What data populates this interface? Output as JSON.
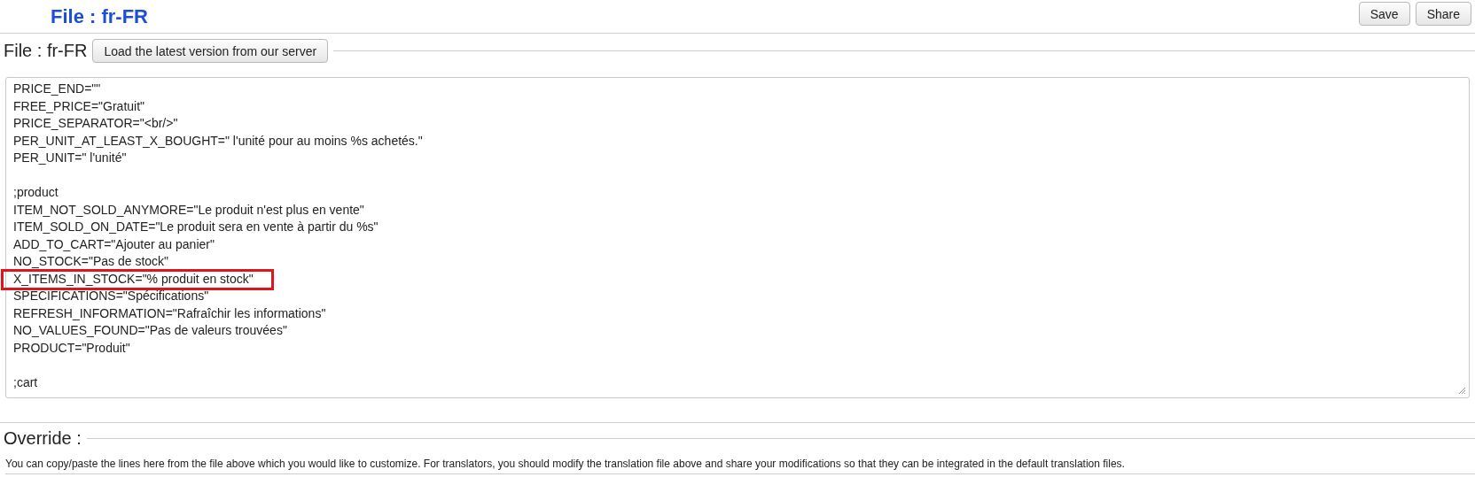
{
  "header": {
    "title": "File : fr-FR",
    "buttons": [
      "Save",
      "Share"
    ]
  },
  "file_section": {
    "legend": "File : fr-FR",
    "load_button": "Load the latest version from our server",
    "lines": [
      {
        "kind": "text",
        "text": "PRICE_END=\"\"",
        "highlighted": false
      },
      {
        "kind": "text",
        "text": "FREE_PRICE=\"Gratuit\"",
        "highlighted": false
      },
      {
        "kind": "text",
        "text": "PRICE_SEPARATOR=\"<br/>\"",
        "highlighted": false
      },
      {
        "kind": "text",
        "text": "PER_UNIT_AT_LEAST_X_BOUGHT=\" l'unité pour au moins %s achetés.\"",
        "highlighted": false
      },
      {
        "kind": "text",
        "text": "PER_UNIT=\" l'unité\"",
        "highlighted": false
      },
      {
        "kind": "blank"
      },
      {
        "kind": "text",
        "text": ";product",
        "highlighted": false
      },
      {
        "kind": "text",
        "text": "ITEM_NOT_SOLD_ANYMORE=\"Le produit n'est plus en vente\"",
        "highlighted": false
      },
      {
        "kind": "text",
        "text": "ITEM_SOLD_ON_DATE=\"Le produit sera en vente à partir du %s\"",
        "highlighted": false
      },
      {
        "kind": "text",
        "text": "ADD_TO_CART=\"Ajouter au panier\"",
        "highlighted": false
      },
      {
        "kind": "text",
        "text": "NO_STOCK=\"Pas de stock\"",
        "highlighted": false
      },
      {
        "kind": "text",
        "text": "X_ITEMS_IN_STOCK=\"% produit en stock\"",
        "highlighted": true
      },
      {
        "kind": "text",
        "text": "SPECIFICATIONS=\"Spécifications\"",
        "highlighted": false
      },
      {
        "kind": "text",
        "text": "REFRESH_INFORMATION=\"Rafraîchir les informations\"",
        "highlighted": false
      },
      {
        "kind": "text",
        "text": "NO_VALUES_FOUND=\"Pas de valeurs trouvées\"",
        "highlighted": false
      },
      {
        "kind": "text",
        "text": "PRODUCT=\"Produit\"",
        "highlighted": false
      },
      {
        "kind": "blank"
      },
      {
        "kind": "text",
        "text": ";cart",
        "highlighted": false
      }
    ]
  },
  "override_section": {
    "legend": "Override :",
    "description": "You can copy/paste the lines here from the file above which you would like to customize. For translators, you should modify the translation file above and share your modifications so that they can be integrated in the default translation files."
  }
}
